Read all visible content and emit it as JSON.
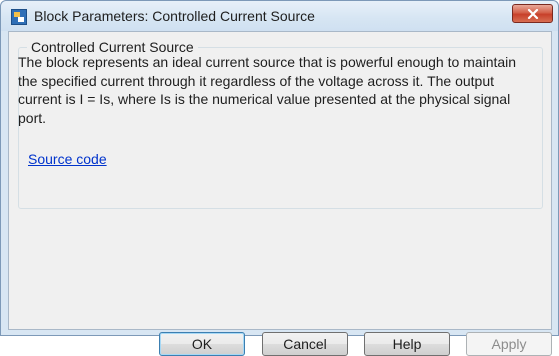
{
  "window": {
    "title": "Block Parameters: Controlled Current Source"
  },
  "group": {
    "title": "Controlled Current Source",
    "description": "The block represents an ideal current source that is powerful enough to maintain the specified current through it regardless of the voltage across it. The output current is I = Is, where Is is the numerical value presented at the physical signal port.",
    "link_label": "Source code"
  },
  "buttons": {
    "ok": "OK",
    "cancel": "Cancel",
    "help": "Help",
    "apply": "Apply"
  },
  "icons": {
    "app": "simulink-block-icon",
    "close": "close-icon"
  },
  "colors": {
    "close_button": "#c7402a",
    "link": "#0033cc",
    "disabled_text": "#8d8d8d"
  }
}
